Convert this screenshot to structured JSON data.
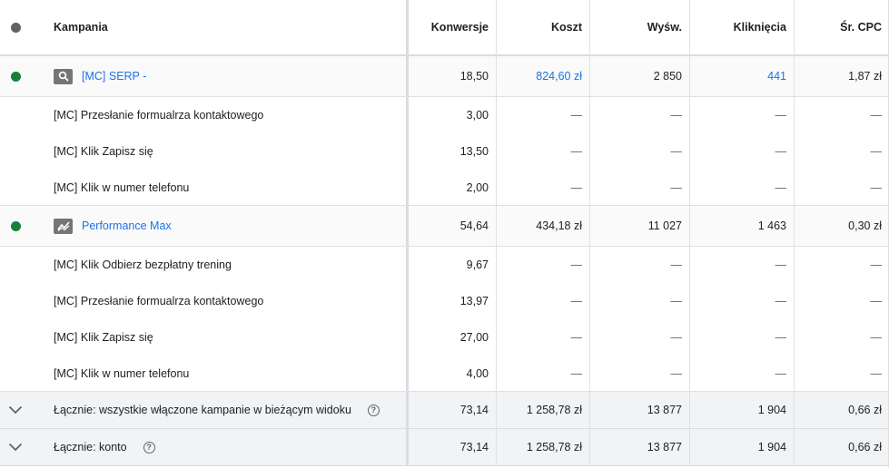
{
  "header": {
    "campaign": "Kampania",
    "conversions": "Konwersje",
    "cost": "Koszt",
    "impressions": "Wyśw.",
    "clicks": "Kliknięcia",
    "avg_cpc": "Śr. CPC"
  },
  "campaigns": [
    {
      "name": "[MC] SERP -",
      "icon": "search-icon",
      "conversions": "18,50",
      "cost": "824,60 zł",
      "impressions": "2 850",
      "clicks": "441",
      "avg_cpc": "1,87 zł",
      "actions": [
        {
          "name": "[MC] Przesłanie formualrza kontaktowego",
          "conversions": "3,00"
        },
        {
          "name": "[MC] Klik Zapisz się",
          "conversions": "13,50"
        },
        {
          "name": "[MC] Klik w numer telefonu",
          "conversions": "2,00"
        }
      ]
    },
    {
      "name": "Performance Max",
      "icon": "performance-max-icon",
      "conversions": "54,64",
      "cost": "434,18 zł",
      "impressions": "11 027",
      "clicks": "1 463",
      "avg_cpc": "0,30 zł",
      "actions": [
        {
          "name": "[MC] Klik Odbierz bezpłatny trening",
          "conversions": "9,67"
        },
        {
          "name": "[MC] Przesłanie formualrza kontaktowego",
          "conversions": "13,97"
        },
        {
          "name": "[MC] Klik Zapisz się",
          "conversions": "27,00"
        },
        {
          "name": "[MC] Klik w numer telefonu",
          "conversions": "4,00"
        }
      ]
    }
  ],
  "dash": "—",
  "totals": [
    {
      "label": "Łącznie: wszystkie włączone kampanie w bieżącym widoku",
      "help": "?",
      "conversions": "73,14",
      "cost": "1 258,78 zł",
      "impressions": "13 877",
      "clicks": "1 904",
      "avg_cpc": "0,66 zł"
    },
    {
      "label": "Łącznie: konto",
      "help": "?",
      "conversions": "73,14",
      "cost": "1 258,78 zł",
      "impressions": "13 877",
      "clicks": "1 904",
      "avg_cpc": "0,66 zł"
    }
  ],
  "colors": {
    "link": "#1a73e8",
    "status_enabled": "#188038",
    "status_header": "#5f6368"
  }
}
